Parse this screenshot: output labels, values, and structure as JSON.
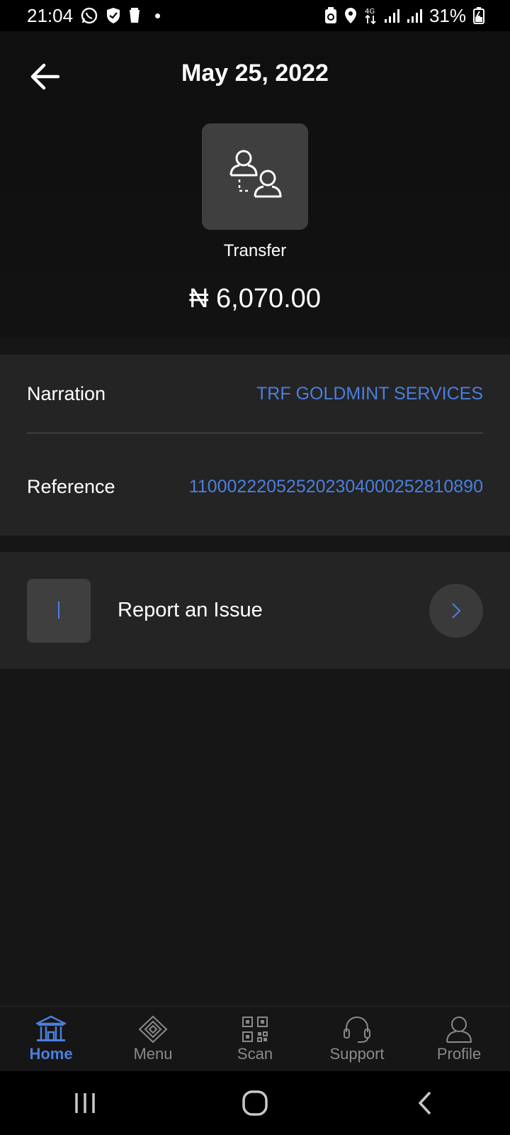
{
  "status_bar": {
    "time": "21:04",
    "network": "4G",
    "battery": "31%",
    "left_icons": [
      "whatsapp-icon",
      "shield-icon",
      "cup-icon"
    ],
    "right_icons": [
      "data-saver-icon",
      "location-icon",
      "network-4g-icon",
      "signal-icon",
      "signal-icon",
      "battery-charging-icon"
    ]
  },
  "header": {
    "back_icon": "arrow-left-icon",
    "title": "May 25, 2022",
    "transaction_icon": "transfer-users-icon",
    "transaction_type": "Transfer",
    "amount": "₦ 6,070.00"
  },
  "details": {
    "narration_label": "Narration",
    "narration_value": "TRF GOLDMINT SERVICES",
    "reference_label": "Reference",
    "reference_value": "110002220525202304000252810890"
  },
  "report": {
    "label": "Report an Issue",
    "icon": "exclamation-icon",
    "arrow_icon": "chevron-right-icon"
  },
  "bottom_nav": {
    "items": [
      {
        "label": "Home",
        "icon": "bank-icon",
        "active": true
      },
      {
        "label": "Menu",
        "icon": "diamond-menu-icon",
        "active": false
      },
      {
        "label": "Scan",
        "icon": "qr-code-icon",
        "active": false
      },
      {
        "label": "Support",
        "icon": "headset-icon",
        "active": false
      },
      {
        "label": "Profile",
        "icon": "user-icon",
        "active": false
      }
    ]
  },
  "system_nav": {
    "icons": [
      "recent-apps-icon",
      "home-circle-icon",
      "back-chevron-icon"
    ]
  },
  "colors": {
    "accent": "#4a7fe0",
    "background": "#161616",
    "card": "#242424",
    "icon_box": "#3f3f3f"
  }
}
